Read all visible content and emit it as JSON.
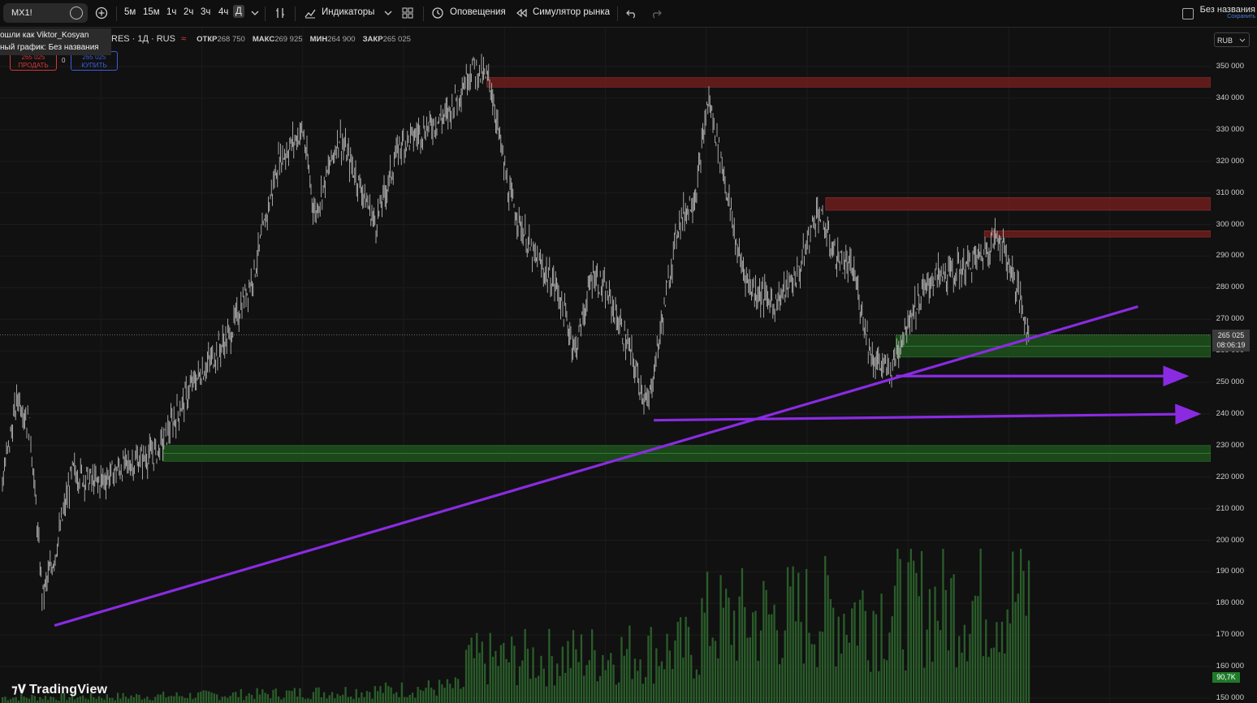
{
  "toolbar": {
    "symbol": "MX1!",
    "timeframes": [
      "5м",
      "15м",
      "1ч",
      "2ч",
      "3ч",
      "4ч",
      "Д"
    ],
    "active_timeframe": "Д",
    "indicators_label": "Индикаторы",
    "alerts_label": "Оповещения",
    "replay_label": "Симулятор рынка",
    "layout_name": "Без названия",
    "save_label": "Сохранить"
  },
  "tooltip": {
    "line1": "ошли как Viktor_Kosyan",
    "line2": "ный график: Без названия"
  },
  "legend": {
    "title": "RES · 1Д · RUS",
    "open_label": "ОТКР",
    "open": "268 750",
    "high_label": "МАКС",
    "high": "269 925",
    "low_label": "МИН",
    "low": "264 900",
    "close_label": "ЗАКР",
    "close": "265 025"
  },
  "trade": {
    "sell_price": "265 025",
    "sell_label": "ПРОДАТЬ",
    "qty": "0",
    "buy_price": "265 025",
    "buy_label": "КУПИТЬ"
  },
  "price_axis": {
    "currency": "RUB",
    "current_price": "265 025",
    "countdown": "08:06:19",
    "volume_label": "90,7K"
  },
  "brand": "TradingView",
  "colors": {
    "background": "#111111",
    "candles": "#b5b5b5",
    "resistance_zone": "#7a1e1e",
    "support_zone": "#1f5a1f",
    "drawing_lines": "#8a2be2",
    "volume": "#2f6b2f"
  },
  "chart_data": {
    "type": "candlestick",
    "y_axis": {
      "ticks": [
        350000,
        340000,
        330000,
        320000,
        310000,
        300000,
        290000,
        280000,
        270000,
        260000,
        250000,
        240000,
        230000,
        220000,
        210000,
        200000,
        190000,
        180000,
        170000,
        160000,
        150000
      ],
      "tick_labels": [
        "350 000",
        "340 000",
        "330 000",
        "320 000",
        "310 000",
        "300 000",
        "290 000",
        "280 000",
        "270 000",
        "260 000",
        "250 000",
        "240 000",
        "230 000",
        "220 000",
        "210 000",
        "200 000",
        "190 000",
        "180 000",
        "170 000",
        "160 000",
        "150 000"
      ],
      "range": [
        148000,
        357000
      ]
    },
    "price_path": [
      [
        0,
        215000
      ],
      [
        0.015,
        246000
      ],
      [
        0.025,
        235000
      ],
      [
        0.035,
        182000
      ],
      [
        0.045,
        195000
      ],
      [
        0.06,
        222000
      ],
      [
        0.08,
        218000
      ],
      [
        0.1,
        223000
      ],
      [
        0.13,
        228000
      ],
      [
        0.16,
        250000
      ],
      [
        0.19,
        265000
      ],
      [
        0.21,
        285000
      ],
      [
        0.23,
        320000
      ],
      [
        0.25,
        330000
      ],
      [
        0.26,
        303000
      ],
      [
        0.28,
        328000
      ],
      [
        0.3,
        310000
      ],
      [
        0.31,
        300000
      ],
      [
        0.33,
        325000
      ],
      [
        0.35,
        330000
      ],
      [
        0.37,
        335000
      ],
      [
        0.39,
        350000
      ],
      [
        0.405,
        345000
      ],
      [
        0.42,
        310000
      ],
      [
        0.44,
        290000
      ],
      [
        0.46,
        280000
      ],
      [
        0.475,
        260000
      ],
      [
        0.49,
        285000
      ],
      [
        0.505,
        275000
      ],
      [
        0.52,
        260000
      ],
      [
        0.535,
        242000
      ],
      [
        0.545,
        265000
      ],
      [
        0.56,
        300000
      ],
      [
        0.575,
        310000
      ],
      [
        0.585,
        340000
      ],
      [
        0.595,
        322000
      ],
      [
        0.61,
        290000
      ],
      [
        0.62,
        280000
      ],
      [
        0.64,
        275000
      ],
      [
        0.66,
        285000
      ],
      [
        0.675,
        305000
      ],
      [
        0.69,
        290000
      ],
      [
        0.705,
        285000
      ],
      [
        0.72,
        258000
      ],
      [
        0.735,
        253000
      ],
      [
        0.75,
        270000
      ],
      [
        0.77,
        283000
      ],
      [
        0.79,
        285000
      ],
      [
        0.81,
        290000
      ],
      [
        0.825,
        297000
      ],
      [
        0.84,
        280000
      ],
      [
        0.85,
        265000
      ]
    ],
    "zones": [
      {
        "kind": "resistance",
        "low": 343500,
        "high": 346500
      },
      {
        "kind": "resistance",
        "low": 304500,
        "high": 308500
      },
      {
        "kind": "resistance",
        "low": 296000,
        "high": 298000
      },
      {
        "kind": "support",
        "low": 258000,
        "high": 265000
      },
      {
        "kind": "support",
        "low": 225000,
        "high": 230000
      }
    ],
    "trendlines": [
      {
        "from": [
          0.045,
          173000
        ],
        "to": [
          0.94,
          274000
        ]
      },
      {
        "from": [
          0.74,
          252000
        ],
        "to": [
          0.98,
          252000
        ],
        "arrow": true
      },
      {
        "from": [
          0.54,
          238000
        ],
        "to": [
          0.99,
          240000
        ],
        "arrow": true
      }
    ],
    "last_price": 265025,
    "grid": true,
    "volume_bars": true
  }
}
